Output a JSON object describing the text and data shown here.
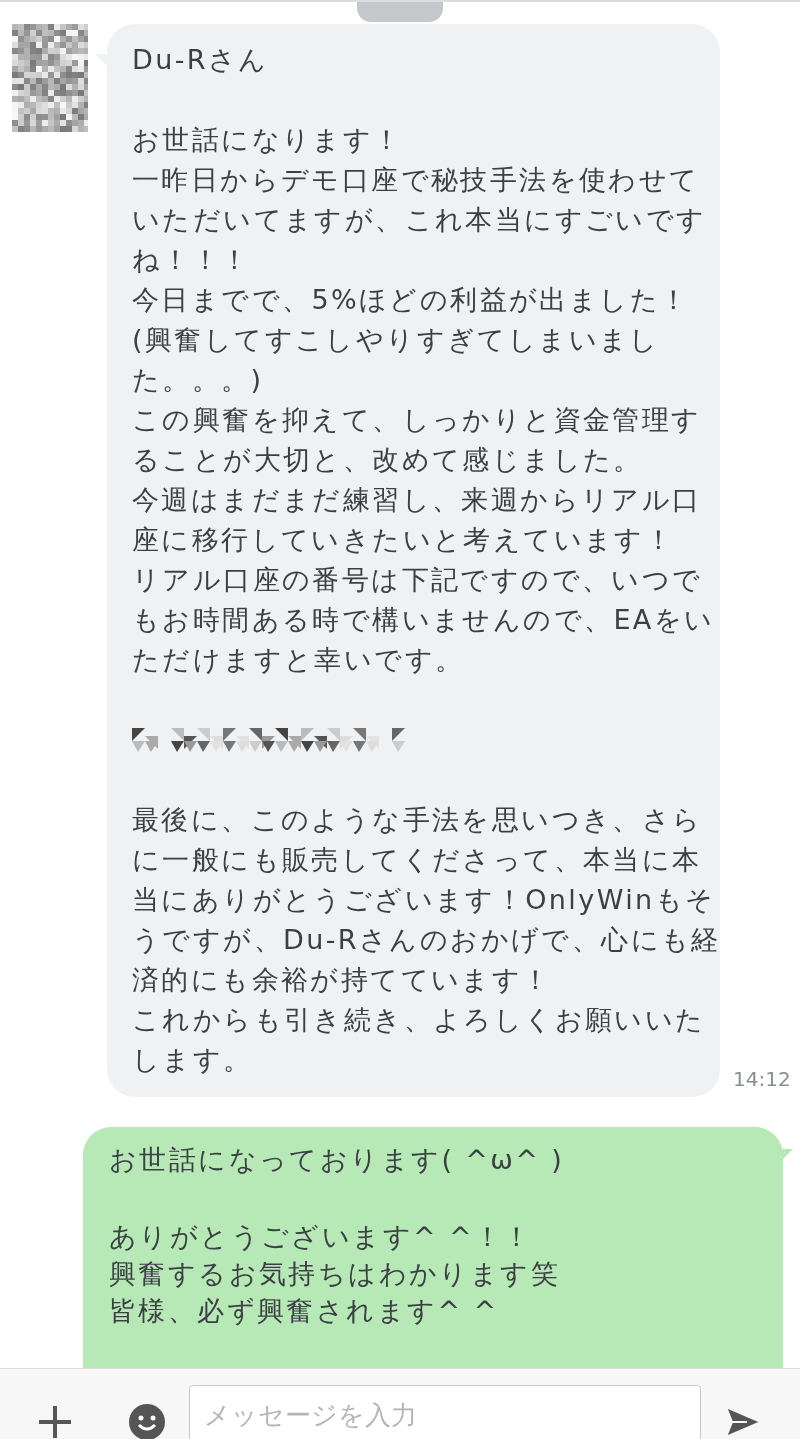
{
  "incoming": {
    "paragraphs": [
      {
        "kind": "text",
        "lines": [
          "Du-Rさん"
        ]
      },
      {
        "kind": "text",
        "lines": [
          "お世話になります！",
          "一昨日からデモ口座で秘技手法を使わせて",
          "いただいてますが、これ本当にすごいです",
          "ね！！！",
          "今日までで、5%ほどの利益が出ました！",
          "(興奮してすこしやりすぎてしまいまし",
          "た。。。)",
          "この興奮を抑えて、しっかりと資金管理す",
          "ることが大切と、改めて感じました。",
          "今週はまだまだ練習し、来週からリアル口",
          "座に移行していきたいと考えています！",
          "リアル口座の番号は下記ですので、いつで",
          "もお時間ある時で構いませんので、EAをい",
          "ただけますと幸いです。"
        ]
      },
      {
        "kind": "redacted"
      },
      {
        "kind": "text",
        "lines": [
          "最後に、このような手法を思いつき、さら",
          "に一般にも販売してくださって、本当に本",
          "当にありがとうございます！OnlyWinもそ",
          "うですが、Du-Rさんのおかげで、心にも経",
          "済的にも余裕が持てています！",
          "これからも引き続き、よろしくお願いいた",
          "します。"
        ]
      }
    ],
    "time": "14:12"
  },
  "outgoing": {
    "paragraphs": [
      {
        "kind": "text",
        "lines": [
          "お世話になっております( ^ω^ )"
        ]
      },
      {
        "kind": "text",
        "lines": [
          "ありがとうございます^ ^！！",
          "興奮するお気持ちはわかります笑",
          "皆様、必ず興奮されます^ ^"
        ]
      }
    ]
  },
  "composer": {
    "placeholder": "メッセージを入力"
  }
}
